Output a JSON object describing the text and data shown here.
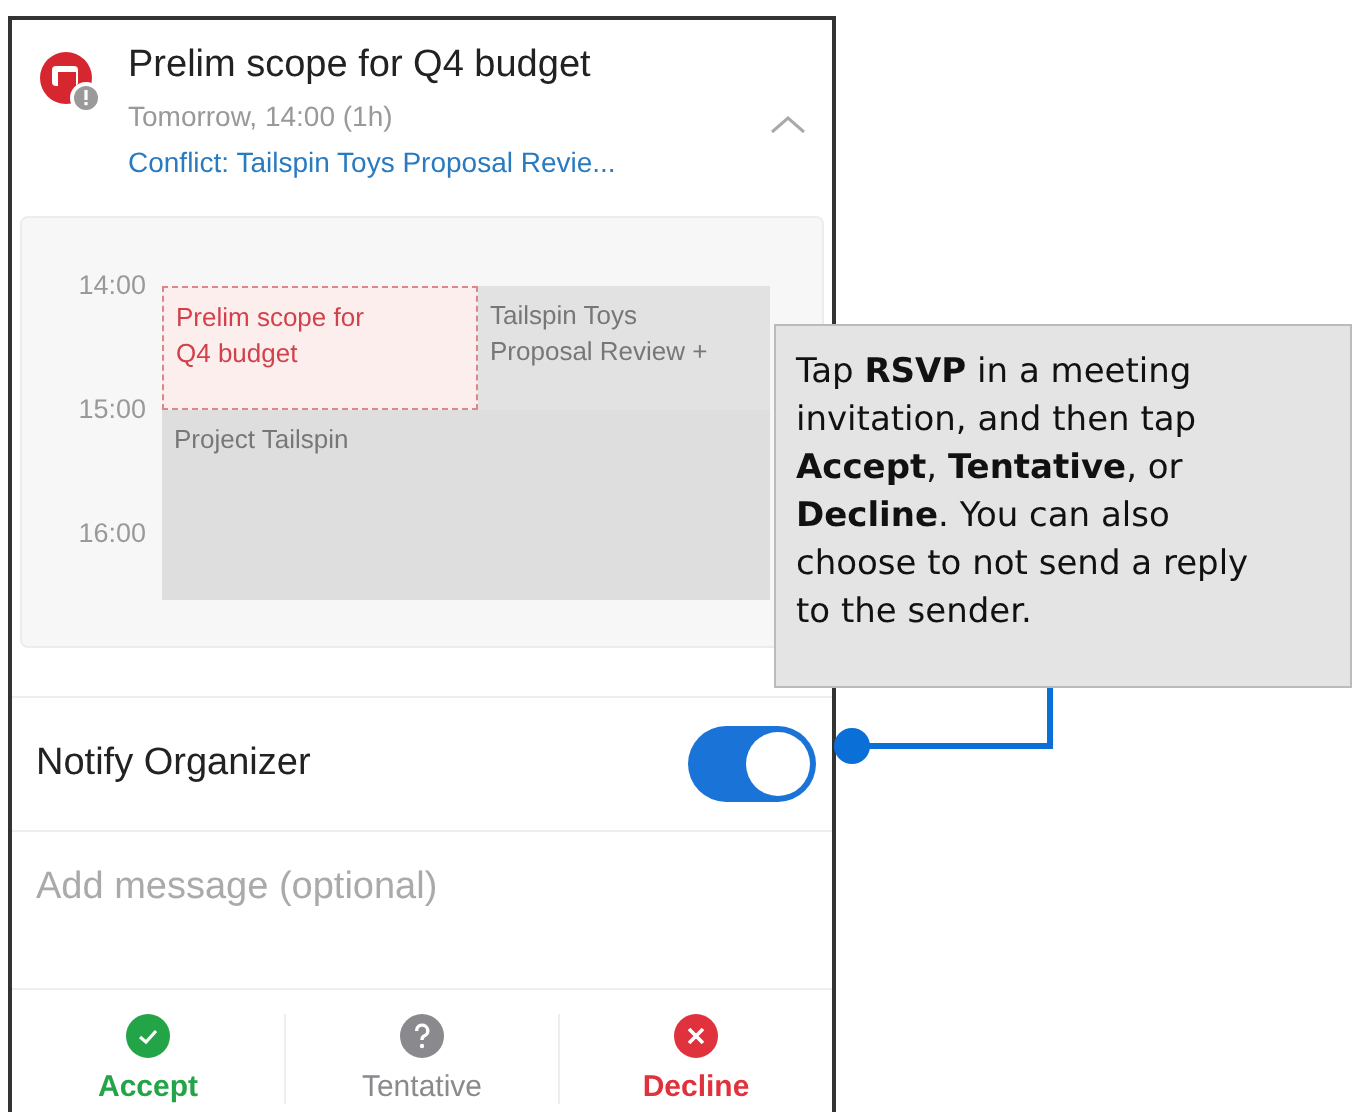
{
  "event": {
    "title": "Prelim scope for Q4 budget",
    "when": "Tomorrow, 14:00 (1h)",
    "conflict": "Conflict: Tailspin Toys Proposal Revie...",
    "expanded": true
  },
  "calendar": {
    "times": [
      "14:00",
      "15:00",
      "16:00"
    ],
    "events": [
      {
        "kind": "proposed",
        "title": "Prelim scope for Q4 budget"
      },
      {
        "kind": "busy",
        "title": "Tailspin Toys Proposal Review +"
      },
      {
        "kind": "busy-wide",
        "title": "Project Tailspin"
      }
    ]
  },
  "notify": {
    "label": "Notify Organizer",
    "on": true
  },
  "message": {
    "placeholder": "Add message (optional)"
  },
  "responses": [
    {
      "kind": "accept",
      "label": "Accept"
    },
    {
      "kind": "tentative",
      "label": "Tentative"
    },
    {
      "kind": "decline",
      "label": "Decline"
    }
  ],
  "callout": {
    "text": "Tap **RSVP** in a meeting invitation, and then tap **Accept**, **Tentative**, or **Decline**. You can also choose to not send a reply to the sender."
  }
}
